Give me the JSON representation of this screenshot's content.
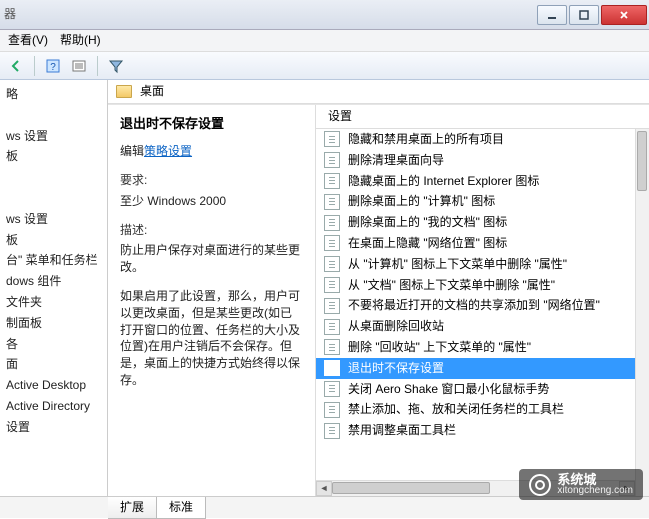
{
  "window": {
    "title_fragment": "器"
  },
  "menu": {
    "view": "查看(V)",
    "help": "帮助(H)"
  },
  "tree": {
    "items": [
      "略",
      "",
      "ws 设置",
      "板",
      "",
      "",
      "ws 设置",
      "板",
      "台\" 菜单和任务栏",
      "dows 组件",
      "文件夹",
      "制面板",
      "各",
      "面",
      "Active Desktop",
      "Active Directory",
      "设置"
    ]
  },
  "path": {
    "label": "桌面"
  },
  "detail": {
    "title": "退出时不保存设置",
    "edit_prefix": "编辑",
    "edit_link": "策略设置",
    "req_label": "要求:",
    "req_value": "至少 Windows 2000",
    "desc_label": "描述:",
    "desc_p1": "防止用户保存对桌面进行的某些更改。",
    "desc_p2": "如果启用了此设置，那么，用户可以更改桌面，但是某些更改(如已打开窗口的位置、任务栏的大小及位置)在用户注销后不会保存。但是，桌面上的快捷方式始终得以保存。"
  },
  "list": {
    "header": "设置",
    "items": [
      "隐藏和禁用桌面上的所有项目",
      "删除清理桌面向导",
      "隐藏桌面上的 Internet Explorer 图标",
      "删除桌面上的 \"计算机\" 图标",
      "删除桌面上的 \"我的文档\" 图标",
      "在桌面上隐藏 \"网络位置\" 图标",
      "从 \"计算机\" 图标上下文菜单中删除 \"属性\"",
      "从 \"文档\" 图标上下文菜单中删除 \"属性\"",
      "不要将最近打开的文档的共享添加到 \"网络位置\"",
      "从桌面删除回收站",
      "删除 \"回收站\" 上下文菜单的 \"属性\"",
      "退出时不保存设置",
      "关闭 Aero Shake 窗口最小化鼠标手势",
      "禁止添加、拖、放和关闭任务栏的工具栏",
      "禁用调整桌面工具栏"
    ],
    "selected_index": 11
  },
  "tabs": {
    "a": "扩展",
    "b": "标准"
  },
  "watermark": {
    "name": "系统城",
    "url": "xitongcheng.com"
  }
}
